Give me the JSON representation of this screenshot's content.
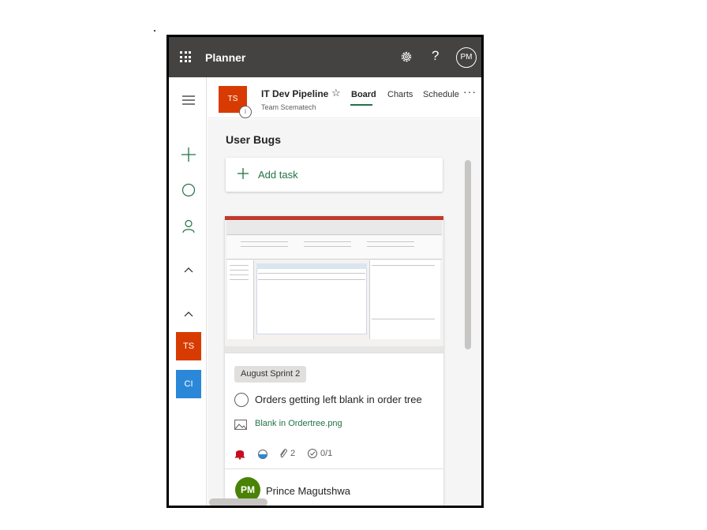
{
  "app": {
    "title": "Planner",
    "user_initials": "PM"
  },
  "topbar_icons": {
    "waffle": "waffle-icon",
    "settings": "gear-icon",
    "help": "?"
  },
  "rail": {
    "icons": [
      "hamburger-icon",
      "plus-icon",
      "circle-icon",
      "person-icon",
      "chevron-up-icon",
      "chevron-up-icon"
    ],
    "plans": [
      {
        "initials": "TS",
        "color": "#d83b01"
      },
      {
        "initials": "CI",
        "color": "#2b88d8"
      }
    ]
  },
  "plan": {
    "tile_initials": "TS",
    "badge": "i",
    "name": "IT Dev Pipeline",
    "star": "☆",
    "group": "Team Scematech",
    "tabs": [
      "Board",
      "Charts",
      "Schedule"
    ],
    "active_tab": "Board",
    "more": "···"
  },
  "bucket": {
    "title": "User Bugs",
    "add_task_label": "Add task"
  },
  "card": {
    "label": "August Sprint 2",
    "title": "Orders getting left blank in order tree",
    "attachment": "Blank in Ordertree.png",
    "attachments_count": "2",
    "checklist": "0/1",
    "priority": "urgent",
    "progress": "in progress",
    "assignee_initials": "PM",
    "assignee_name": "Prince Magutshwa"
  },
  "colors": {
    "accent": "#217346",
    "topbar": "#444342",
    "urgent": "#c50f1f"
  }
}
